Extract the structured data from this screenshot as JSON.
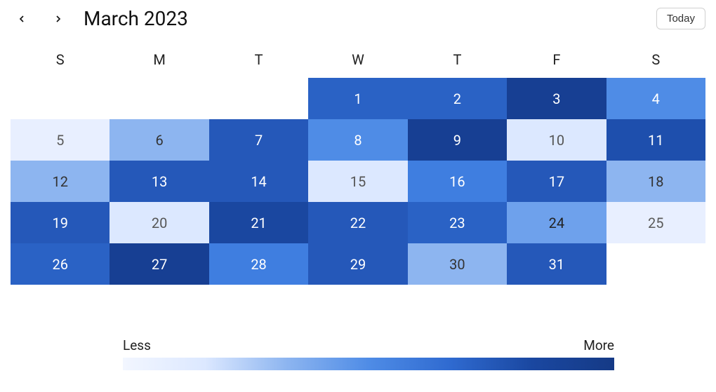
{
  "header": {
    "title": "March 2023",
    "today_label": "Today"
  },
  "weekdays": [
    "S",
    "M",
    "T",
    "W",
    "T",
    "F",
    "S"
  ],
  "legend": {
    "less": "Less",
    "more": "More"
  },
  "days": [
    {
      "n": "",
      "level": null
    },
    {
      "n": "",
      "level": null
    },
    {
      "n": "",
      "level": null
    },
    {
      "n": "1",
      "level": 9
    },
    {
      "n": "2",
      "level": 9
    },
    {
      "n": "3",
      "level": 13
    },
    {
      "n": "4",
      "level": 5
    },
    {
      "n": "5",
      "level": 0
    },
    {
      "n": "6",
      "level": 3
    },
    {
      "n": "7",
      "level": 10
    },
    {
      "n": "8",
      "level": 5
    },
    {
      "n": "9",
      "level": 13
    },
    {
      "n": "10",
      "level": 1
    },
    {
      "n": "11",
      "level": 11
    },
    {
      "n": "12",
      "level": 3
    },
    {
      "n": "13",
      "level": 10
    },
    {
      "n": "14",
      "level": 10
    },
    {
      "n": "15",
      "level": 1
    },
    {
      "n": "16",
      "level": 6
    },
    {
      "n": "17",
      "level": 10
    },
    {
      "n": "18",
      "level": 3
    },
    {
      "n": "19",
      "level": 10
    },
    {
      "n": "20",
      "level": 1
    },
    {
      "n": "21",
      "level": 12
    },
    {
      "n": "22",
      "level": 10
    },
    {
      "n": "23",
      "level": 9
    },
    {
      "n": "24",
      "level": 4
    },
    {
      "n": "25",
      "level": 0
    },
    {
      "n": "26",
      "level": 9
    },
    {
      "n": "27",
      "level": 13
    },
    {
      "n": "28",
      "level": 6
    },
    {
      "n": "29",
      "level": 10
    },
    {
      "n": "30",
      "level": 3
    },
    {
      "n": "31",
      "level": 10
    }
  ],
  "chart_data": {
    "type": "heatmap",
    "title": "March 2023",
    "weekdays": [
      "S",
      "M",
      "T",
      "W",
      "T",
      "F",
      "S"
    ],
    "scale": {
      "min_label": "Less",
      "max_label": "More",
      "levels": 14
    },
    "cells": [
      {
        "day": 1,
        "level": 9
      },
      {
        "day": 2,
        "level": 9
      },
      {
        "day": 3,
        "level": 13
      },
      {
        "day": 4,
        "level": 5
      },
      {
        "day": 5,
        "level": 0
      },
      {
        "day": 6,
        "level": 3
      },
      {
        "day": 7,
        "level": 10
      },
      {
        "day": 8,
        "level": 5
      },
      {
        "day": 9,
        "level": 13
      },
      {
        "day": 10,
        "level": 1
      },
      {
        "day": 11,
        "level": 11
      },
      {
        "day": 12,
        "level": 3
      },
      {
        "day": 13,
        "level": 10
      },
      {
        "day": 14,
        "level": 10
      },
      {
        "day": 15,
        "level": 1
      },
      {
        "day": 16,
        "level": 6
      },
      {
        "day": 17,
        "level": 10
      },
      {
        "day": 18,
        "level": 3
      },
      {
        "day": 19,
        "level": 10
      },
      {
        "day": 20,
        "level": 1
      },
      {
        "day": 21,
        "level": 12
      },
      {
        "day": 22,
        "level": 10
      },
      {
        "day": 23,
        "level": 9
      },
      {
        "day": 24,
        "level": 4
      },
      {
        "day": 25,
        "level": 0
      },
      {
        "day": 26,
        "level": 9
      },
      {
        "day": 27,
        "level": 13
      },
      {
        "day": 28,
        "level": 6
      },
      {
        "day": 29,
        "level": 10
      },
      {
        "day": 30,
        "level": 3
      },
      {
        "day": 31,
        "level": 10
      }
    ]
  }
}
